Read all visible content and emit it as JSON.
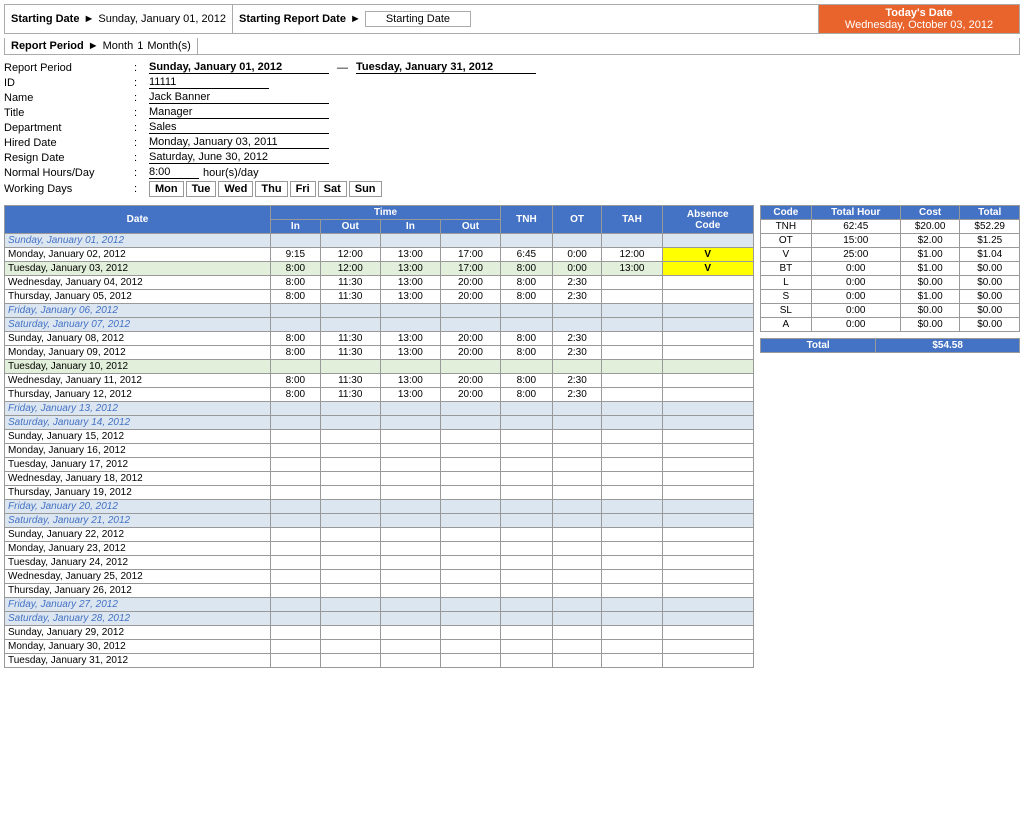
{
  "header": {
    "starting_date_label": "Starting Date",
    "starting_date_value": "Sunday, January 01, 2012",
    "starting_report_date_label": "Starting Report Date",
    "starting_report_date_value": "Starting Date",
    "report_period_label": "Report Period",
    "report_period_value": "Month",
    "report_period_num": "1",
    "report_period_unit": "Month(s)",
    "today_label": "Today's Date",
    "today_value": "Wednesday, October 03, 2012"
  },
  "info": {
    "report_period_label": "Report Period",
    "report_period_start": "Sunday, January 01, 2012",
    "report_period_end": "Tuesday, January 31, 2012",
    "id_label": "ID",
    "id_value": "11111",
    "name_label": "Name",
    "name_value": "Jack Banner",
    "title_label": "Title",
    "title_value": "Manager",
    "dept_label": "Department",
    "dept_value": "Sales",
    "hired_label": "Hired Date",
    "hired_value": "Monday, January 03, 2011",
    "resign_label": "Resign Date",
    "resign_value": "Saturday, June 30, 2012",
    "normal_hours_label": "Normal Hours/Day",
    "normal_hours_value": "8:00",
    "normal_hours_unit": "hour(s)/day",
    "working_days_label": "Working Days",
    "days": [
      "Mon",
      "Tue",
      "Wed",
      "Thu",
      "Fri",
      "Sat",
      "Sun"
    ]
  },
  "table_headers": {
    "date": "Date",
    "time": "Time",
    "in1": "In",
    "out1": "Out",
    "in2": "In",
    "out2": "Out",
    "tnh": "TNH",
    "ot": "OT",
    "tah": "TAH",
    "absence_code": "Absence Code"
  },
  "rows": [
    {
      "date": "Sunday, January 01, 2012",
      "type": "sunday",
      "in1": "",
      "out1": "",
      "in2": "",
      "out2": "",
      "tnh": "",
      "ot": "",
      "tah": "",
      "absence": ""
    },
    {
      "date": "Monday, January 02, 2012",
      "type": "normal",
      "in1": "9:15",
      "out1": "12:00",
      "in2": "13:00",
      "out2": "17:00",
      "tnh": "6:45",
      "ot": "0:00",
      "tah": "12:00",
      "absence": "V"
    },
    {
      "date": "Tuesday, January 03, 2012",
      "type": "tuesday",
      "in1": "8:00",
      "out1": "12:00",
      "in2": "13:00",
      "out2": "17:00",
      "tnh": "8:00",
      "ot": "0:00",
      "tah": "13:00",
      "absence": "V"
    },
    {
      "date": "Wednesday, January 04, 2012",
      "type": "normal",
      "in1": "8:00",
      "out1": "11:30",
      "in2": "13:00",
      "out2": "20:00",
      "tnh": "8:00",
      "ot": "2:30",
      "tah": "",
      "absence": ""
    },
    {
      "date": "Thursday, January 05, 2012",
      "type": "normal",
      "in1": "8:00",
      "out1": "11:30",
      "in2": "13:00",
      "out2": "20:00",
      "tnh": "8:00",
      "ot": "2:30",
      "tah": "",
      "absence": ""
    },
    {
      "date": "Friday, January 06, 2012",
      "type": "friday",
      "in1": "",
      "out1": "",
      "in2": "",
      "out2": "",
      "tnh": "",
      "ot": "",
      "tah": "",
      "absence": ""
    },
    {
      "date": "Saturday, January 07, 2012",
      "type": "saturday",
      "in1": "",
      "out1": "",
      "in2": "",
      "out2": "",
      "tnh": "",
      "ot": "",
      "tah": "",
      "absence": ""
    },
    {
      "date": "Sunday, January 08, 2012",
      "type": "normal",
      "in1": "8:00",
      "out1": "11:30",
      "in2": "13:00",
      "out2": "20:00",
      "tnh": "8:00",
      "ot": "2:30",
      "tah": "",
      "absence": ""
    },
    {
      "date": "Monday, January 09, 2012",
      "type": "normal",
      "in1": "8:00",
      "out1": "11:30",
      "in2": "13:00",
      "out2": "20:00",
      "tnh": "8:00",
      "ot": "2:30",
      "tah": "",
      "absence": ""
    },
    {
      "date": "Tuesday, January 10, 2012",
      "type": "tuesday",
      "in1": "",
      "out1": "",
      "in2": "",
      "out2": "",
      "tnh": "",
      "ot": "",
      "tah": "",
      "absence": ""
    },
    {
      "date": "Wednesday, January 11, 2012",
      "type": "normal",
      "in1": "8:00",
      "out1": "11:30",
      "in2": "13:00",
      "out2": "20:00",
      "tnh": "8:00",
      "ot": "2:30",
      "tah": "",
      "absence": ""
    },
    {
      "date": "Thursday, January 12, 2012",
      "type": "normal",
      "in1": "8:00",
      "out1": "11:30",
      "in2": "13:00",
      "out2": "20:00",
      "tnh": "8:00",
      "ot": "2:30",
      "tah": "",
      "absence": ""
    },
    {
      "date": "Friday, January 13, 2012",
      "type": "friday",
      "in1": "",
      "out1": "",
      "in2": "",
      "out2": "",
      "tnh": "",
      "ot": "",
      "tah": "",
      "absence": ""
    },
    {
      "date": "Saturday, January 14, 2012",
      "type": "saturday",
      "in1": "",
      "out1": "",
      "in2": "",
      "out2": "",
      "tnh": "",
      "ot": "",
      "tah": "",
      "absence": ""
    },
    {
      "date": "Sunday, January 15, 2012",
      "type": "normal",
      "in1": "",
      "out1": "",
      "in2": "",
      "out2": "",
      "tnh": "",
      "ot": "",
      "tah": "",
      "absence": ""
    },
    {
      "date": "Monday, January 16, 2012",
      "type": "normal",
      "in1": "",
      "out1": "",
      "in2": "",
      "out2": "",
      "tnh": "",
      "ot": "",
      "tah": "",
      "absence": ""
    },
    {
      "date": "Tuesday, January 17, 2012",
      "type": "normal",
      "in1": "",
      "out1": "",
      "in2": "",
      "out2": "",
      "tnh": "",
      "ot": "",
      "tah": "",
      "absence": ""
    },
    {
      "date": "Wednesday, January 18, 2012",
      "type": "normal",
      "in1": "",
      "out1": "",
      "in2": "",
      "out2": "",
      "tnh": "",
      "ot": "",
      "tah": "",
      "absence": ""
    },
    {
      "date": "Thursday, January 19, 2012",
      "type": "normal",
      "in1": "",
      "out1": "",
      "in2": "",
      "out2": "",
      "tnh": "",
      "ot": "",
      "tah": "",
      "absence": ""
    },
    {
      "date": "Friday, January 20, 2012",
      "type": "friday",
      "in1": "",
      "out1": "",
      "in2": "",
      "out2": "",
      "tnh": "",
      "ot": "",
      "tah": "",
      "absence": ""
    },
    {
      "date": "Saturday, January 21, 2012",
      "type": "saturday",
      "in1": "",
      "out1": "",
      "in2": "",
      "out2": "",
      "tnh": "",
      "ot": "",
      "tah": "",
      "absence": ""
    },
    {
      "date": "Sunday, January 22, 2012",
      "type": "normal",
      "in1": "",
      "out1": "",
      "in2": "",
      "out2": "",
      "tnh": "",
      "ot": "",
      "tah": "",
      "absence": ""
    },
    {
      "date": "Monday, January 23, 2012",
      "type": "normal",
      "in1": "",
      "out1": "",
      "in2": "",
      "out2": "",
      "tnh": "",
      "ot": "",
      "tah": "",
      "absence": ""
    },
    {
      "date": "Tuesday, January 24, 2012",
      "type": "normal",
      "in1": "",
      "out1": "",
      "in2": "",
      "out2": "",
      "tnh": "",
      "ot": "",
      "tah": "",
      "absence": ""
    },
    {
      "date": "Wednesday, January 25, 2012",
      "type": "normal",
      "in1": "",
      "out1": "",
      "in2": "",
      "out2": "",
      "tnh": "",
      "ot": "",
      "tah": "",
      "absence": ""
    },
    {
      "date": "Thursday, January 26, 2012",
      "type": "normal",
      "in1": "",
      "out1": "",
      "in2": "",
      "out2": "",
      "tnh": "",
      "ot": "",
      "tah": "",
      "absence": ""
    },
    {
      "date": "Friday, January 27, 2012",
      "type": "friday",
      "in1": "",
      "out1": "",
      "in2": "",
      "out2": "",
      "tnh": "",
      "ot": "",
      "tah": "",
      "absence": ""
    },
    {
      "date": "Saturday, January 28, 2012",
      "type": "saturday",
      "in1": "",
      "out1": "",
      "in2": "",
      "out2": "",
      "tnh": "",
      "ot": "",
      "tah": "",
      "absence": ""
    },
    {
      "date": "Sunday, January 29, 2012",
      "type": "normal",
      "in1": "",
      "out1": "",
      "in2": "",
      "out2": "",
      "tnh": "",
      "ot": "",
      "tah": "",
      "absence": ""
    },
    {
      "date": "Monday, January 30, 2012",
      "type": "normal",
      "in1": "",
      "out1": "",
      "in2": "",
      "out2": "",
      "tnh": "",
      "ot": "",
      "tah": "",
      "absence": ""
    },
    {
      "date": "Tuesday, January 31, 2012",
      "type": "normal",
      "in1": "",
      "out1": "",
      "in2": "",
      "out2": "",
      "tnh": "",
      "ot": "",
      "tah": "",
      "absence": ""
    }
  ],
  "summary": {
    "headers": [
      "Code",
      "Total Hour",
      "Cost",
      "Total"
    ],
    "rows": [
      {
        "code": "TNH",
        "hour": "62:45",
        "cost": "$20.00",
        "total": "$52.29"
      },
      {
        "code": "OT",
        "hour": "15:00",
        "cost": "$2.00",
        "total": "$1.25"
      },
      {
        "code": "V",
        "hour": "25:00",
        "cost": "$1.00",
        "total": "$1.04"
      },
      {
        "code": "BT",
        "hour": "0:00",
        "cost": "$1.00",
        "total": "$0.00"
      },
      {
        "code": "L",
        "hour": "0:00",
        "cost": "$0.00",
        "total": "$0.00"
      },
      {
        "code": "S",
        "hour": "0:00",
        "cost": "$1.00",
        "total": "$0.00"
      },
      {
        "code": "SL",
        "hour": "0:00",
        "cost": "$0.00",
        "total": "$0.00"
      },
      {
        "code": "A",
        "hour": "0:00",
        "cost": "$0.00",
        "total": "$0.00"
      }
    ],
    "total_label": "Total",
    "total_value": "$54.58"
  }
}
